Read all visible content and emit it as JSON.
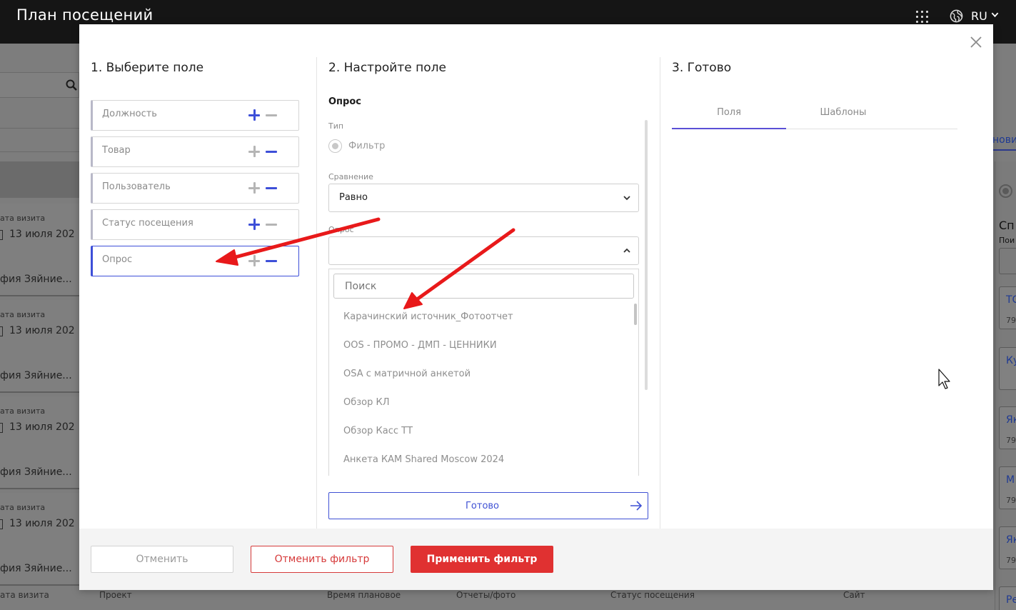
{
  "app": {
    "title": "План посещений",
    "lang": "RU"
  },
  "icons": {
    "apps": "grid-icon",
    "language": "globe-icon",
    "close": "close-icon",
    "add": "plus-icon",
    "remove": "minus-icon",
    "chevron": "chevron-icon",
    "arrow": "arrow-right-icon",
    "cursor": "mouse-pointer-icon"
  },
  "colors": {
    "accent": "#3d4fd8",
    "danger": "#e03131",
    "annotation": "#e8191a",
    "tab_underline": "#5b4fd6"
  },
  "background": {
    "cards": [
      {
        "label": "ата визита",
        "date": "13 июля 202",
        "name": "фия Зяйние..."
      },
      {
        "label": "ата визита",
        "date": "13 июля 202",
        "name": "фия Зяйние..."
      },
      {
        "label": "ата визита",
        "date": "13 июля 202",
        "name": "фия Зяйние..."
      },
      {
        "label": "ата визита",
        "date": "13 июля 202",
        "name": "фия Зяйние..."
      }
    ],
    "footer_row": {
      "c0": "ата визита",
      "c1": "Проект",
      "c2": "Время плановое",
      "c3": "Отчеты/фото",
      "c4": "Статус посещения",
      "c5": "Сайт"
    },
    "right": {
      "link": "нови",
      "heading": "Сп",
      "subheading": "Пои",
      "cards": [
        {
          "title": "ТС",
          "num": "79"
        },
        {
          "title": "Ку",
          "num": "79"
        },
        {
          "title": "Як",
          "num": "79"
        },
        {
          "title": "М",
          "num": "79"
        },
        {
          "title": "Як",
          "num": "79"
        },
        {
          "title": "Ре",
          "num": ""
        }
      ]
    }
  },
  "modal": {
    "step1": {
      "title": "1. Выберите поле",
      "fields": [
        {
          "label": "Должность",
          "plus_active": true,
          "minus_active": false
        },
        {
          "label": "Товар",
          "plus_active": false,
          "minus_active": true
        },
        {
          "label": "Пользователь",
          "plus_active": false,
          "minus_active": true
        },
        {
          "label": "Статус посещения",
          "plus_active": true,
          "minus_active": false
        },
        {
          "label": "Опрос",
          "plus_active": false,
          "minus_active": true,
          "selected": true
        }
      ]
    },
    "step2": {
      "title": "2. Настройте поле",
      "field_name": "Опрос",
      "type_label": "Тип",
      "type_value": "Фильтр",
      "compare_label": "Сравнение",
      "compare_value": "Равно",
      "survey_label": "Опрос",
      "search_placeholder": "Поиск",
      "options": [
        "Карачинский источник_Фотоотчет",
        "OOS - ПРОМО - ДМП - ЦЕННИКИ",
        "OSA с матричной анкетой",
        "Обзор КЛ",
        "Обзор Касс ТТ",
        "Анкета КАМ Shared Moscow 2024"
      ],
      "done_label": "Готово"
    },
    "step3": {
      "title": "3. Готово",
      "tabs": [
        {
          "label": "Поля",
          "active": true
        },
        {
          "label": "Шаблоны",
          "active": false
        }
      ]
    },
    "footer": {
      "cancel": "Отменить",
      "reset": "Отменить фильтр",
      "apply": "Применить фильтр"
    }
  }
}
